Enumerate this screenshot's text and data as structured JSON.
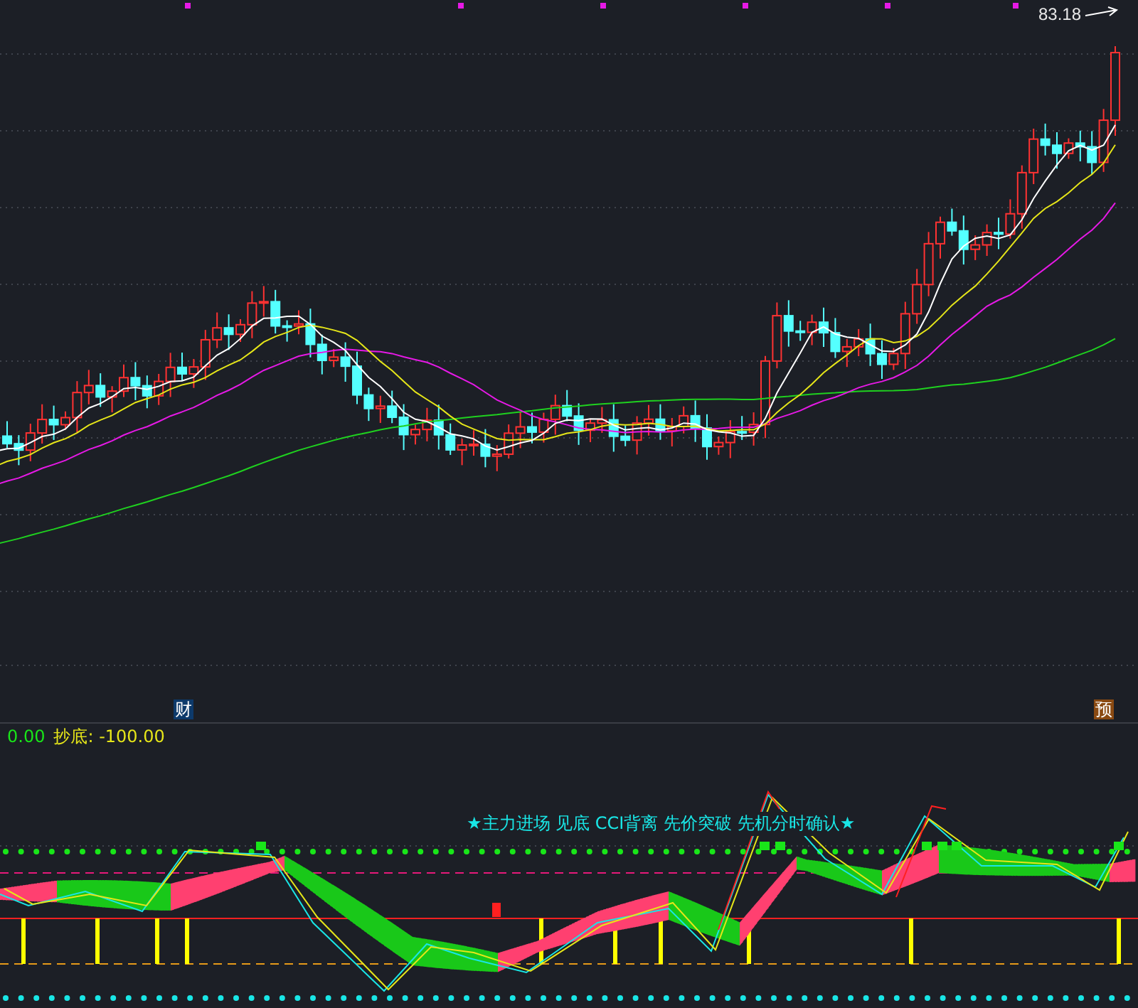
{
  "price_pane": {
    "high_label": "83.18",
    "event_markers": [
      {
        "label": "财",
        "kind": "finance"
      },
      {
        "label": "预",
        "kind": "forecast"
      }
    ]
  },
  "indicator_pane": {
    "readings": [
      {
        "text": "0.00",
        "color": "#19e619"
      },
      {
        "text": "抄底: -100.00",
        "color": "#e6e619"
      }
    ],
    "signal_legend": "★主力进场 见底 CCI背离 先价突破 先机分时确认★"
  }
}
